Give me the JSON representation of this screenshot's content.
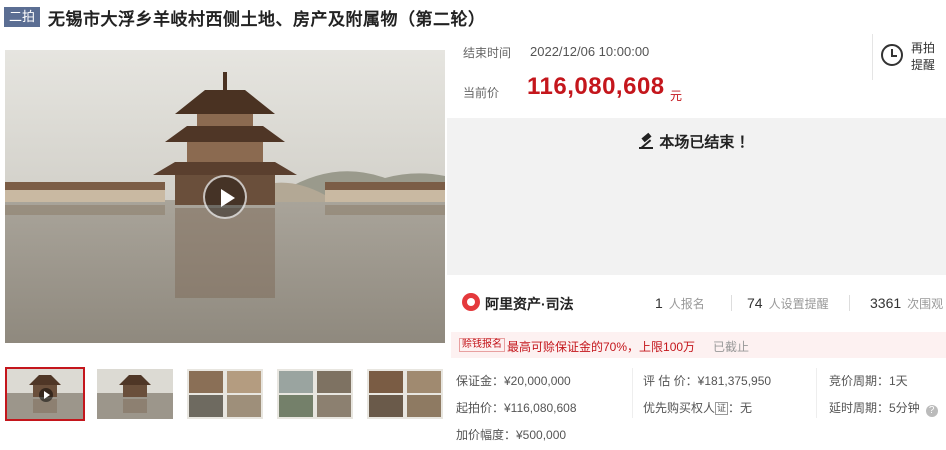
{
  "header": {
    "round_badge": "二拍",
    "title": "无锡市大浮乡羊岐村西侧土地、房产及附属物（第二轮）"
  },
  "auction": {
    "end_time_label": "结束时间",
    "end_time": "2022/12/06 10:00:00",
    "current_price_label": "当前价",
    "current_price": "116,080,608",
    "currency_unit": "元",
    "remind_label": "再拍提醒",
    "ended_message": "本场已结束 ！"
  },
  "brand": {
    "name": "阿里资产·司法",
    "logo_color": "#e4393c"
  },
  "stats": {
    "registered_count": "1",
    "registered_label": "人报名",
    "reminder_count": "74",
    "reminder_label": "人设置提醒",
    "view_count": "3361",
    "view_label": "次围观"
  },
  "notice": {
    "tag": "赊钱报名",
    "text": "最高可赊保证金的70%，上限100万",
    "status": "已截止"
  },
  "details": {
    "deposit": "保证金：¥20,000,000",
    "starting_price": "起拍价：¥116,080,608",
    "increment": "加价幅度：¥500,000",
    "appraisal": "评 估 价：¥181,375,950",
    "priority_prefix": "优先购买权人",
    "priority_value": "：无",
    "bidding_period": "竞价周期：1天",
    "delay_period": "延时周期：5分钟"
  },
  "colors": {
    "accent_red": "#c4161c",
    "badge_blue": "#5b6e93",
    "ended_bg": "#f2f2f2"
  }
}
